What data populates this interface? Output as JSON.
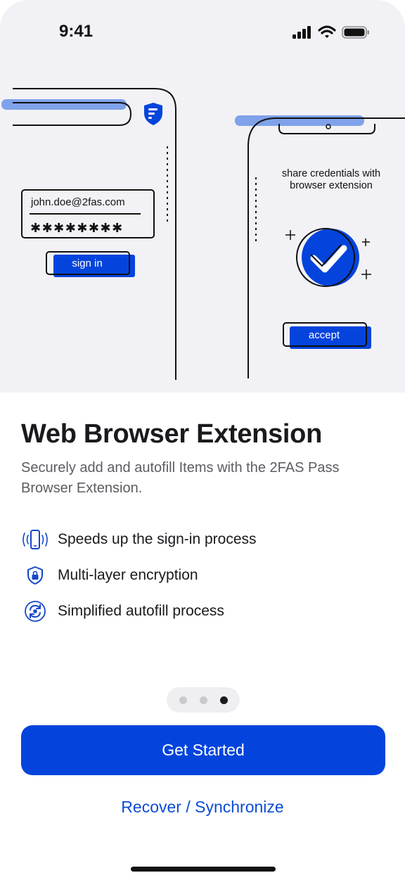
{
  "status_bar": {
    "time": "9:41"
  },
  "illustration": {
    "email": "john.doe@2fas.com",
    "password_mask": "✱✱✱✱✱✱✱✱",
    "sign_in_label": "sign in",
    "share_line1": "share credentials with",
    "share_line2": "browser extension",
    "accept_label": "accept"
  },
  "title": "Web Browser Extension",
  "subtitle": "Securely add and autofill Items with the 2FAS Pass Browser Extension.",
  "features": [
    {
      "icon": "phone-signal-icon",
      "label": "Speeds up the sign-in process"
    },
    {
      "icon": "shield-lock-icon",
      "label": "Multi-layer encryption"
    },
    {
      "icon": "autofill-cycle-icon",
      "label": "Simplified autofill process"
    }
  ],
  "pagination": {
    "total": 3,
    "current": 3
  },
  "primary_button": "Get Started",
  "secondary_link": "Recover / Synchronize",
  "colors": {
    "accent": "#0444dc",
    "link": "#0b4cd4",
    "highlight": "#7fa2ea",
    "hero_bg": "#f2f2f6"
  }
}
